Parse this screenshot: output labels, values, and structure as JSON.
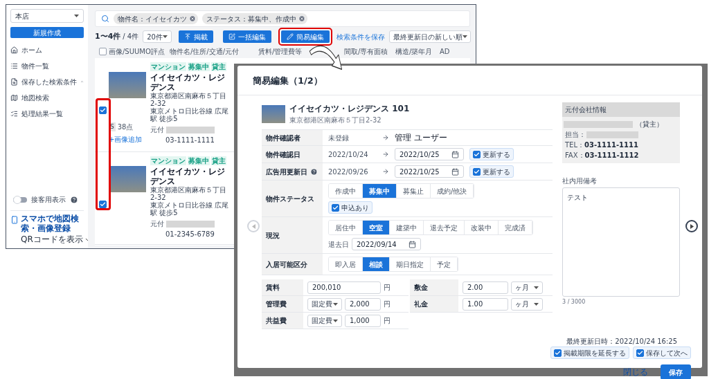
{
  "sidebar": {
    "store": "本店",
    "new_button": "新規作成",
    "nav": [
      {
        "label": "ホーム"
      },
      {
        "label": "物件一覧"
      },
      {
        "label": "保存した検索条件",
        "expanded": true
      },
      {
        "label": "地図検索"
      },
      {
        "label": "処理結果一覧"
      }
    ],
    "guest_mode": {
      "label": "接客用表示",
      "on": false
    },
    "mobile_promo": {
      "title": "スマホで地図検索・画像登録",
      "link": "QRコードを表示"
    }
  },
  "search": {
    "chips": [
      {
        "label": "物件名：イイセイカツ"
      },
      {
        "label": "ステータス：募集中、作成中"
      }
    ]
  },
  "toolbar": {
    "range": "1〜4件",
    "total": "/ 4件",
    "per_page": "20件",
    "buttons": [
      {
        "label": "掲載",
        "highlighted": false
      },
      {
        "label": "一括編集",
        "highlighted": false
      },
      {
        "label": "簡易編集",
        "highlighted": true
      }
    ],
    "save_search": "検索条件を保存",
    "sort": "最終更新日の新しい順"
  },
  "table": {
    "select_all": {
      "checked": false
    },
    "columns": [
      "画像/SUUMO評点",
      "物件名/住所/交通/元付",
      "賃料/管理費等",
      "間取/専有面積",
      "構造/築年月",
      "AD"
    ]
  },
  "listings": [
    {
      "tags": [
        "マンション",
        "募集中",
        "貸主"
      ],
      "name": "イイセイカツ・レジデンス",
      "address": "東京都港区南麻布５丁目2-32",
      "access": "東京メトロ日比谷線 広尾駅 徒歩5",
      "source_label": "元付",
      "phone": "03-1111-1111",
      "selected": true,
      "score_grade": "S",
      "score": "38点",
      "add_image": "+画像追加"
    },
    {
      "tags": [
        "マンション",
        "募集中",
        "貸主"
      ],
      "name": "イイセイカツ・レジデンス",
      "address": "東京都港区南麻布５丁目2-32",
      "access": "東京メトロ日比谷線 広尾駅 徒歩5",
      "source_label": "元付",
      "phone": "01-2345-6789",
      "selected": true
    }
  ],
  "annotations": {
    "checkbox_column_highlighted": true
  },
  "modal": {
    "title": "簡易編集（1/2）",
    "property": {
      "name": "イイセイカツ・レジデンス 101",
      "address": "東京都港区南麻布５丁目2-32"
    },
    "rows": [
      {
        "kind": "text",
        "label": "物件確認者",
        "from": "未登録",
        "to": "管理 ユーザー"
      },
      {
        "kind": "date",
        "label": "物件確認日",
        "help": false,
        "from": "2022/10/24",
        "date": "2022/10/25",
        "update": {
          "label": "更新する",
          "checked": true
        }
      },
      {
        "kind": "date",
        "label": "広告用更新日",
        "help": true,
        "from": "2022/09/26",
        "date": "2022/10/25",
        "update": {
          "label": "更新する",
          "checked": true
        }
      },
      {
        "kind": "segments",
        "label": "物件ステータス",
        "options": [
          {
            "label": "作成中",
            "selected": false
          },
          {
            "label": "募集中",
            "selected": true
          },
          {
            "label": "募集止",
            "selected": false
          },
          {
            "label": "成約/他決",
            "selected": false
          }
        ],
        "checkbox": {
          "label": "申込あり",
          "checked": true
        }
      },
      {
        "kind": "segments",
        "label": "現況",
        "options": [
          {
            "label": "居住中",
            "selected": false
          },
          {
            "label": "空室",
            "selected": true
          },
          {
            "label": "建築中",
            "selected": false
          },
          {
            "label": "退去予定",
            "selected": false
          },
          {
            "label": "改装中",
            "selected": false
          },
          {
            "label": "完成済",
            "selected": false
          }
        ],
        "date_field": {
          "label": "退去日",
          "value": "2022/09/14"
        }
      },
      {
        "kind": "segments",
        "label": "入居可能区分",
        "options": [
          {
            "label": "即入居",
            "selected": false
          },
          {
            "label": "相談",
            "selected": true
          },
          {
            "label": "期日指定",
            "selected": false
          },
          {
            "label": "予定",
            "selected": false
          }
        ]
      }
    ],
    "fees_left": [
      {
        "label": "賃料",
        "value": "200,010",
        "unit": "円"
      },
      {
        "label": "管理費",
        "select": "固定費",
        "value": "2,000",
        "unit": "円"
      },
      {
        "label": "共益費",
        "select": "固定費",
        "value": "1,000",
        "unit": "円"
      }
    ],
    "fees_right": [
      {
        "label": "敷金",
        "value": "2.00",
        "select": "ヶ月"
      },
      {
        "label": "礼金",
        "value": "1.00",
        "select": "ヶ月"
      }
    ],
    "source_company": {
      "title": "元付会社情報",
      "role": "（貸主）",
      "contact_label": "担当：",
      "tel_label": "TEL：",
      "tel": "03-1111-1111",
      "fax_label": "FAX：",
      "fax": "03-1111-1112"
    },
    "memo": {
      "label": "社内用備考",
      "value": "テスト",
      "counter": "3 / 3000"
    },
    "last_updated": "最終更新日時：2022/10/24 16:25",
    "footer_checks": [
      {
        "label": "掲載期限を延長する",
        "checked": true
      },
      {
        "label": "保存して次へ",
        "checked": true
      }
    ],
    "close": "閉じる",
    "save": "保存"
  }
}
